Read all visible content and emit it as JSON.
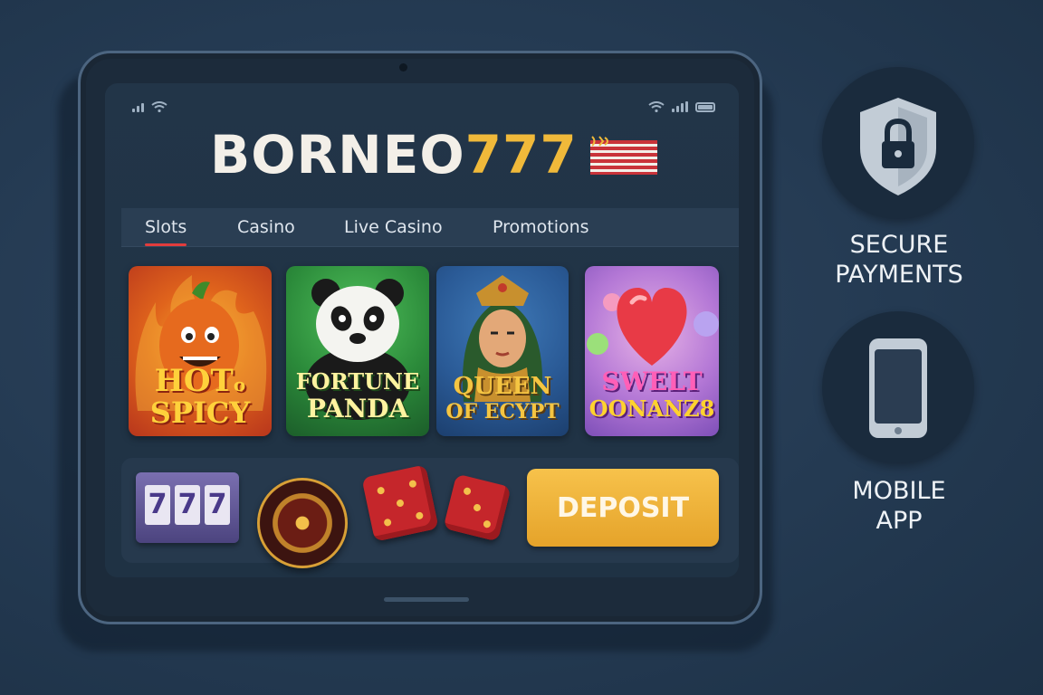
{
  "brand": {
    "name_part1": "BORNEO",
    "name_part2": "777",
    "flag_mark": "ῼ"
  },
  "nav": {
    "tabs": [
      {
        "label": "Slots",
        "active": true
      },
      {
        "label": "Casino",
        "active": false
      },
      {
        "label": "Live Casino",
        "active": false
      },
      {
        "label": "Promotions",
        "active": false
      }
    ]
  },
  "games": [
    {
      "title_line1": "HOT",
      "title_line2": "SPICY",
      "title_connector": "o"
    },
    {
      "title_line1": "FORTUNE",
      "title_line2": "PANDA"
    },
    {
      "title_line1": "QUEEN",
      "title_line2": "OF ECYPT"
    },
    {
      "title_line1": "SWELT",
      "title_line2": "OONANZ8"
    }
  ],
  "slot_machine": {
    "reels": [
      "7",
      "7",
      "7"
    ]
  },
  "deposit": {
    "label": "DEPOSIT"
  },
  "features": [
    {
      "label_line1": "SECURE",
      "label_line2": "PAYMENTS",
      "icon": "shield-lock-icon"
    },
    {
      "label_line1": "MOBILE",
      "label_line2": "APP",
      "icon": "smartphone-icon"
    }
  ],
  "colors": {
    "background": "#243a52",
    "accent_gold": "#f0b93a",
    "active_tab_underline": "#e33c3c",
    "deposit_button": "#f2b73f"
  }
}
